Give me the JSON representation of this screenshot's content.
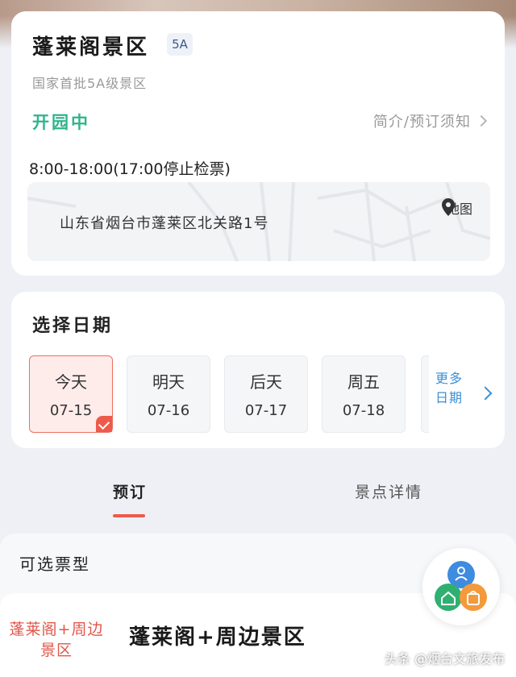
{
  "header": {
    "title": "蓬莱阁景区",
    "badge": "5A",
    "subtitle": "国家首批5A级景区",
    "status": "开园中",
    "intro_link": "简介/预订须知",
    "hours": "8:00-18:00(17:00停止检票)",
    "address": "山东省烟台市蓬莱区北关路1号",
    "map_label": "地图"
  },
  "date_picker": {
    "heading": "选择日期",
    "dates": [
      {
        "day": "今天",
        "date": "07-15",
        "selected": true
      },
      {
        "day": "明天",
        "date": "07-16",
        "selected": false
      },
      {
        "day": "后天",
        "date": "07-17",
        "selected": false
      },
      {
        "day": "周五",
        "date": "07-18",
        "selected": false
      }
    ],
    "more_label": "更多日期"
  },
  "tabs": {
    "book": "预订",
    "detail": "景点详情"
  },
  "tickets": {
    "heading": "可选票型",
    "thumb_label": "蓬莱阁+周边景区",
    "first_name": "蓬莱阁+周边景区"
  },
  "watermark": "头条 @烟台文旅发布",
  "colors": {
    "status_green": "#2fb58a",
    "accent_red": "#ee5a4a",
    "link_blue": "#3b8fd6"
  }
}
